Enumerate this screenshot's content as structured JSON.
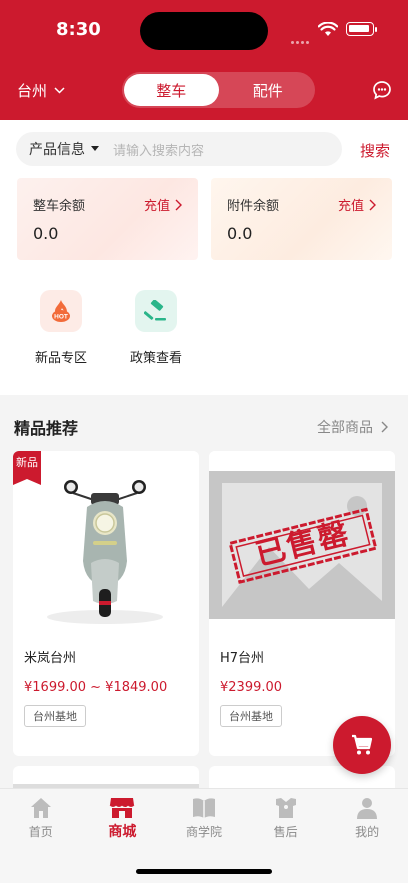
{
  "status": {
    "time": "8:30"
  },
  "header": {
    "city": "台州",
    "tabs": [
      {
        "label": "整车",
        "active": true
      },
      {
        "label": "配件",
        "active": false
      }
    ]
  },
  "search": {
    "category": "产品信息",
    "placeholder": "请输入搜索内容",
    "button": "搜索"
  },
  "balances": [
    {
      "title": "整车余额",
      "action": "充值",
      "value": "0.0"
    },
    {
      "title": "附件余额",
      "action": "充值",
      "value": "0.0"
    }
  ],
  "quick_links": [
    {
      "label": "新品专区",
      "icon": "hot-icon"
    },
    {
      "label": "政策查看",
      "icon": "gavel-icon"
    }
  ],
  "recommend": {
    "title": "精品推荐",
    "more": "全部商品",
    "products": [
      {
        "name": "米岚台州",
        "price": "¥1699.00 ~ ¥1849.00",
        "tag": "台州基地",
        "badge": "新品"
      },
      {
        "name": "H7台州",
        "price": "¥2399.00",
        "tag": "台州基地",
        "stamp": "已售罄"
      }
    ]
  },
  "tabbar": [
    {
      "label": "首页",
      "icon": "home-icon",
      "active": false
    },
    {
      "label": "商城",
      "icon": "shop-icon",
      "active": true
    },
    {
      "label": "商学院",
      "icon": "book-icon",
      "active": false
    },
    {
      "label": "售后",
      "icon": "service-icon",
      "active": false
    },
    {
      "label": "我的",
      "icon": "user-icon",
      "active": false
    }
  ],
  "colors": {
    "brand": "#cc1a2e",
    "hot": "#f26b3a",
    "policy": "#2ab58a"
  }
}
